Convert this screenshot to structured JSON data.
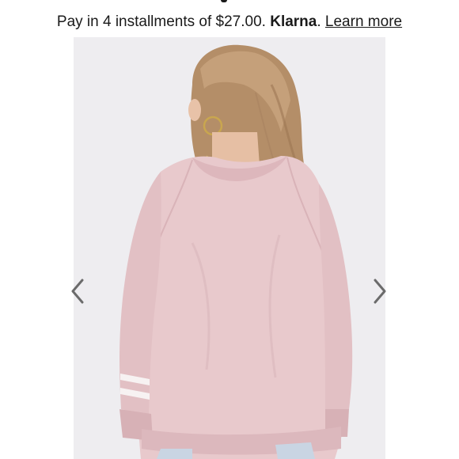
{
  "klarna": {
    "prefix": "Pay in 4 installments of $27.00.",
    "brand": "Klarna",
    "period": ".",
    "learn_more": "Learn more"
  },
  "gallery": {
    "image_subject": "pink-raglan-sweatshirt-back-view",
    "prev_icon": "chevron-left-icon",
    "next_icon": "chevron-right-icon"
  },
  "colors": {
    "sweatshirt": "#e8c9cc",
    "background": "#ebeaee",
    "text": "#1a1a1a",
    "arrow": "#6b6b6b"
  }
}
